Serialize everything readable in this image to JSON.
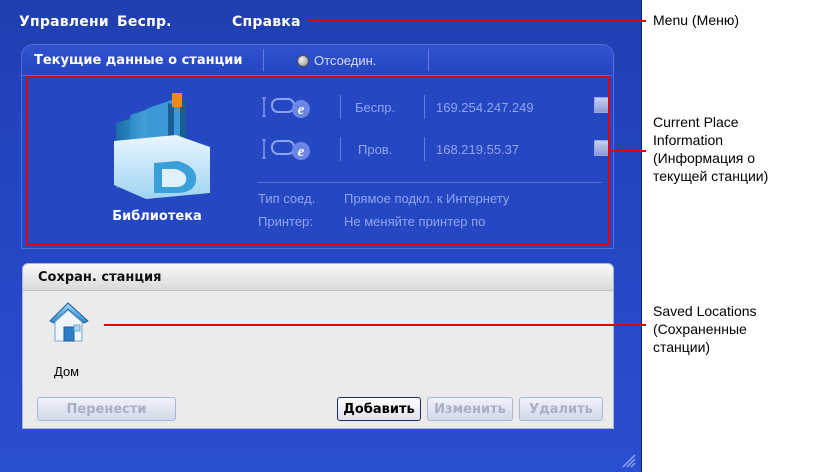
{
  "menu": {
    "items": [
      "Управлени",
      "Беспр.",
      "Справка"
    ]
  },
  "current_station": {
    "title": "Текущие данные о станции",
    "status": "Отсоедин.",
    "location_name": "Библиотека",
    "connections": [
      {
        "type_label": "Беспр.",
        "ip": "169.254.247.249",
        "icon": "network-ie-icon",
        "button_icon": "scroll-up-icon"
      },
      {
        "type_label": "Пров.",
        "ip": "168.219.55.37",
        "icon": "network-ie-icon",
        "button_icon": "scroll-down-icon"
      }
    ],
    "info": [
      {
        "key": "Тип соед.",
        "value": "Прямое подкл. к Интернету"
      },
      {
        "key": "Принтер:",
        "value": "Не меняйте принтер по"
      }
    ]
  },
  "saved_locations": {
    "title": "Сохран. станция",
    "items": [
      {
        "label": "Дом",
        "icon": "home-icon"
      }
    ],
    "buttons": {
      "move": "Перенести",
      "add": "Добавить",
      "edit": "Изменить",
      "delete": "Удалить"
    }
  },
  "annotations": {
    "menu": "Menu (Меню)",
    "current_place": [
      "Current Place",
      "Information",
      "(Информация о",
      "текущей станции)"
    ],
    "saved": [
      "Saved Locations",
      "(Сохраненные",
      "станции)"
    ],
    "color": "#e30000"
  }
}
